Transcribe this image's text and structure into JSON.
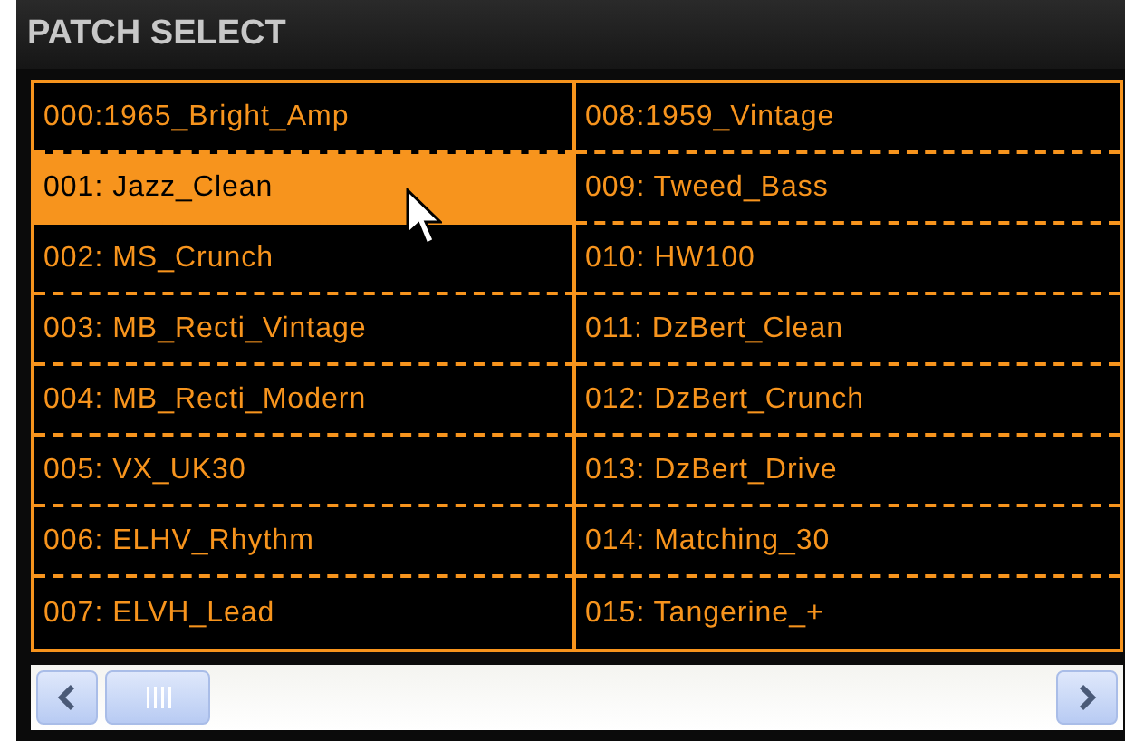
{
  "panel": {
    "title": "PATCH SELECT"
  },
  "patches": [
    {
      "label": "000:1965_Bright_Amp",
      "selected": false
    },
    {
      "label": "001: Jazz_Clean",
      "selected": true
    },
    {
      "label": "002: MS_Crunch",
      "selected": false
    },
    {
      "label": "003: MB_Recti_Vintage",
      "selected": false
    },
    {
      "label": "004: MB_Recti_Modern",
      "selected": false
    },
    {
      "label": "005: VX_UK30",
      "selected": false
    },
    {
      "label": "006: ELHV_Rhythm",
      "selected": false
    },
    {
      "label": "007: ELVH_Lead",
      "selected": false
    },
    {
      "label": "008:1959_Vintage",
      "selected": false
    },
    {
      "label": "009: Tweed_Bass",
      "selected": false
    },
    {
      "label": "010: HW100",
      "selected": false
    },
    {
      "label": "011: DzBert_Clean",
      "selected": false
    },
    {
      "label": "012: DzBert_Crunch",
      "selected": false
    },
    {
      "label": "013: DzBert_Drive",
      "selected": false
    },
    {
      "label": "014: Matching_30",
      "selected": false
    },
    {
      "label": "015: Tangerine_+",
      "selected": false
    }
  ]
}
